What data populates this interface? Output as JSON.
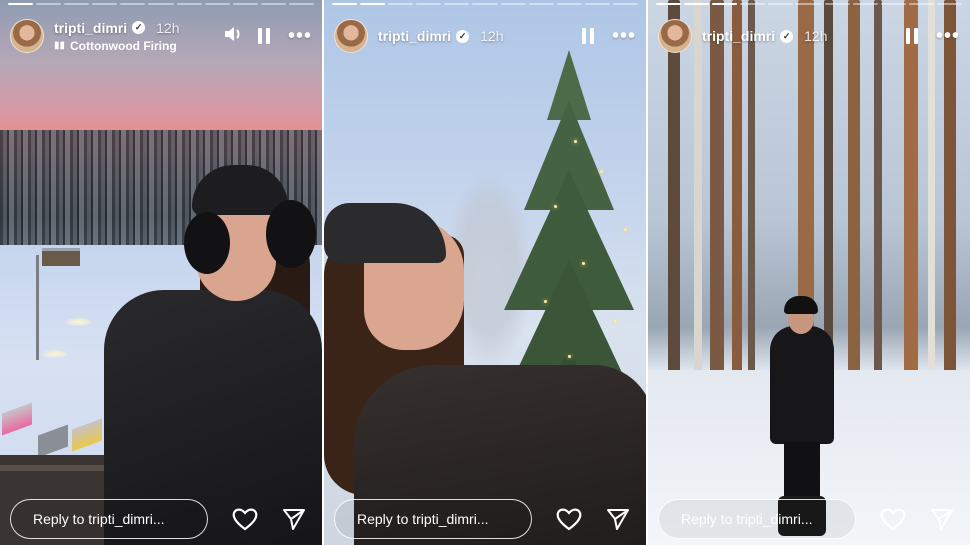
{
  "stories": [
    {
      "username": "tripti_dimri",
      "verified_icon": "verified-badge-icon",
      "time": "12h",
      "music": "Cottonwood Firing",
      "progress": {
        "segments": 11,
        "completed": 1
      },
      "reply_placeholder": "Reply to tripti_dimri...",
      "has_sound_control": true
    },
    {
      "username": "tripti_dimri",
      "verified_icon": "verified-badge-icon",
      "time": "12h",
      "progress": {
        "segments": 11,
        "completed": 2
      },
      "reply_placeholder": "Reply to tripti_dimri...",
      "has_sound_control": false
    },
    {
      "username": "tripti_dimri",
      "verified_icon": "verified-badge-icon",
      "time": "12h",
      "progress": {
        "segments": 11,
        "completed": 3
      },
      "reply_placeholder": "Reply to tripti_dimri...",
      "has_sound_control": false
    }
  ],
  "icons": {
    "music": "music-note-icon",
    "sound": "speaker-icon",
    "pause": "pause-icon",
    "more": "more-options-icon",
    "like": "heart-icon",
    "share": "send-icon"
  },
  "colors": {
    "ui_text": "#ffffff",
    "divider": "#ffffff"
  }
}
